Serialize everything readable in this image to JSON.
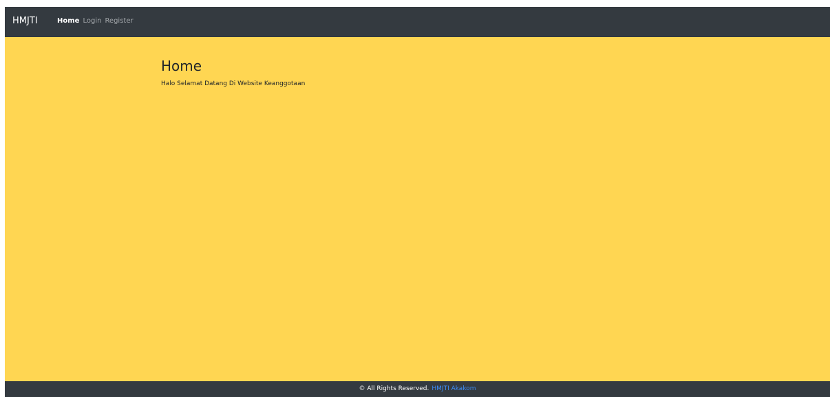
{
  "navbar": {
    "brand": "HMJTI",
    "links": [
      {
        "label": "Home",
        "active": true
      },
      {
        "label": "Login",
        "active": false
      },
      {
        "label": "Register",
        "active": false
      }
    ]
  },
  "main": {
    "title": "Home",
    "welcome_text": "Halo Selamat Datang Di Website Keanggotaan"
  },
  "footer": {
    "copyright": "© All Rights Reserved.",
    "link_text": "HMJTI Akakom"
  },
  "colors": {
    "navbar_bg": "#343a40",
    "page_bg": "#ffd652",
    "link_accent": "#3d8ef8",
    "text_dark": "#212529"
  }
}
